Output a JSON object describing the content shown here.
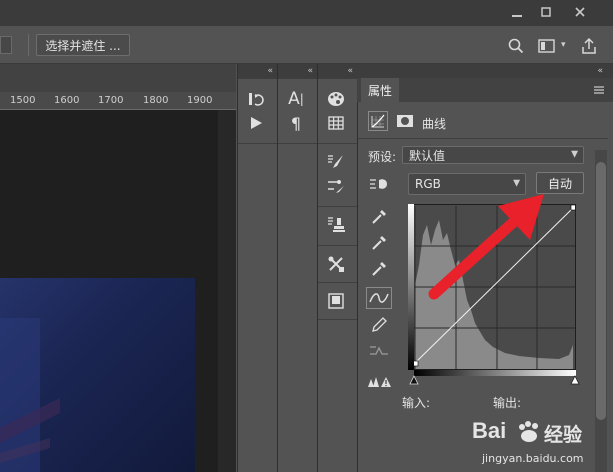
{
  "window": {
    "minimize_icon": "minimize-icon",
    "maximize_icon": "maximize-icon",
    "close_icon": "close-icon"
  },
  "options_bar": {
    "select_mask_label": "选择并遮住 ..."
  },
  "ruler": {
    "ticks": [
      "1500",
      "1600",
      "1700",
      "1800",
      "1900"
    ]
  },
  "properties": {
    "tab_label": "属性",
    "adjustment_name": "曲线",
    "preset_label": "预设:",
    "preset_value": "默认值",
    "channel_value": "RGB",
    "auto_button": "自动",
    "input_label": "输入:",
    "output_label": "输出:"
  },
  "watermark": {
    "brand": "Bai",
    "brand2": "经验",
    "url": "jingyan.baidu.com"
  },
  "colors": {
    "arrow": "#e8212a",
    "panel": "#535353",
    "titlebar": "#3b3b3b"
  }
}
